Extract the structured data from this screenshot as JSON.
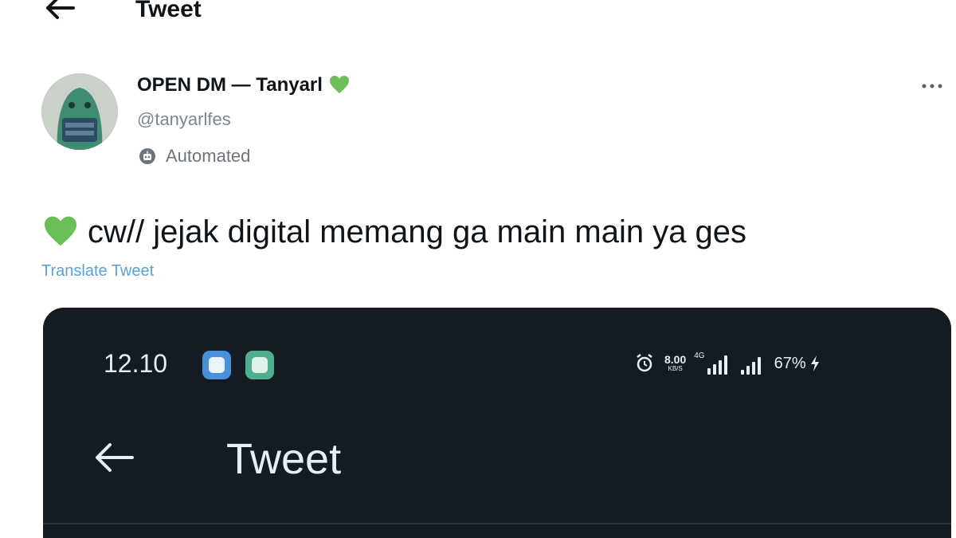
{
  "header": {
    "title": "Tweet",
    "back_icon": "arrow-left-icon"
  },
  "author": {
    "display_name": "OPEN DM — Tanyarl",
    "name_emoji": "green-heart-icon",
    "handle": "@tanyarlfes",
    "automated_label": "Automated",
    "more_icon": "more-horizontal-icon"
  },
  "tweet": {
    "emoji": "green-heart-icon",
    "text": "cw// jejak digital memang ga main main ya ges",
    "translate_label": "Translate Tweet"
  },
  "embedded_screenshot": {
    "status_time": "12.10",
    "net_speed_value": "8.00",
    "net_speed_unit": "KB/S",
    "signal_tag": "4G",
    "battery": "67%",
    "title": "Tweet"
  },
  "colors": {
    "heart": "#6bbf59",
    "link": "#5aa2d8",
    "embed_background": "#141b23"
  }
}
